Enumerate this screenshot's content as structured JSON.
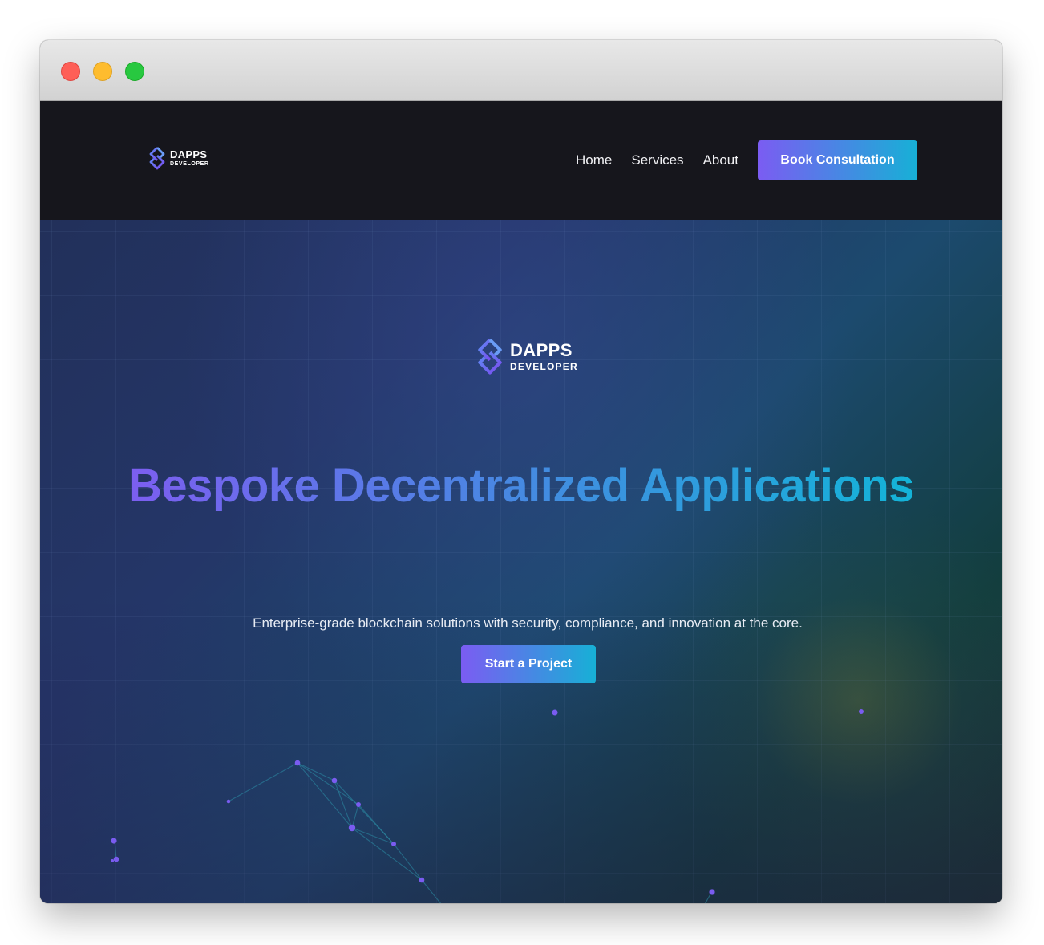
{
  "window": {
    "controls": [
      "close",
      "minimize",
      "zoom"
    ]
  },
  "nav": {
    "logo": {
      "line1": "DAPPS",
      "line2": "DEVELOPER"
    },
    "links": [
      {
        "label": "Home"
      },
      {
        "label": "Services"
      },
      {
        "label": "About"
      }
    ],
    "cta_label": "Book Consultation"
  },
  "hero": {
    "logo": {
      "line1": "DAPPS",
      "line2": "DEVELOPER"
    },
    "headline": "Bespoke Decentralized Applications",
    "subhead": "Enterprise-grade blockchain solutions with security, compliance, and innovation at the core.",
    "cta_label": "Start a Project"
  },
  "colors": {
    "gradient_start": "#7b5cf2",
    "gradient_end": "#17b0d6",
    "nav_background": "#16161c",
    "node_color": "#7a5cf0"
  },
  "icons": {
    "logo_mark": "interlocking-diamond-icon"
  }
}
